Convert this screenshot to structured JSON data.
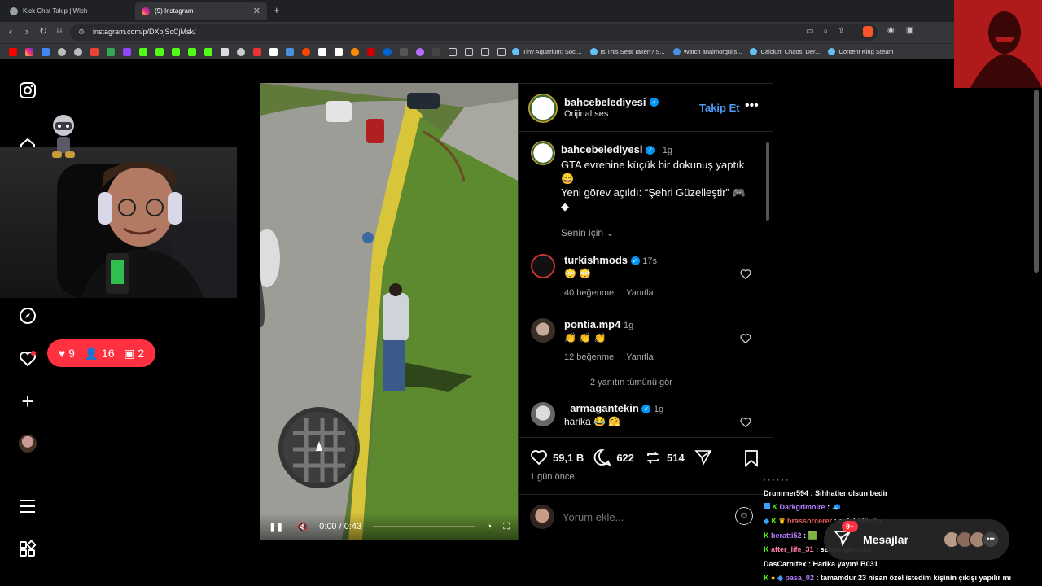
{
  "browser": {
    "tabs": [
      {
        "title": "Kick Chat Takip | Wich"
      },
      {
        "title": "(9) Instagram"
      }
    ],
    "url": "instagram.com/p/DXbjScCjMsk/",
    "bookmarks": [
      "Tiny Aquarium: Soci...",
      "Is This Seat Taken? S...",
      "Watch analmorgulis...",
      "Calcium Chaos: Der...",
      "Content King Steam"
    ]
  },
  "notifications": {
    "likes": "9",
    "follows": "16",
    "tags": "2"
  },
  "post": {
    "username": "bahcebelediyesi",
    "audio": "Orijinal ses",
    "follow": "Takip Et",
    "caption_time": "1g",
    "caption_line1": "GTA evrenine küçük bir dokunuş yaptık",
    "caption_line2": "Yeni görev açıldı: “Şehri Güzelleştir”",
    "for_you": "Senin için",
    "comments": [
      {
        "user": "turkishmods",
        "time": "17s",
        "text": "😳 😳",
        "likes": "40 beğenme",
        "reply": "Yanıtla"
      },
      {
        "user": "pontia.mp4",
        "time": "1g",
        "text": "👏 👏 👏",
        "likes": "12 beğenme",
        "reply": "Yanıtla"
      },
      {
        "user": "_armagantekin",
        "time": "1g",
        "text": "harika 😂 🤗",
        "likes": "",
        "reply": ""
      }
    ],
    "view_replies": "2 yanıtın tümünü gör",
    "like_count": "59,1 B",
    "comment_count": "622",
    "repost_count": "514",
    "posted": "1 gün önce",
    "comment_placeholder": "Yorum ekle...",
    "video_time": "0:00 / 0:43"
  },
  "chat": [
    {
      "user": "Drummer594",
      "msg": ": Sıhhatler olsun bedir",
      "color": "#ffffff"
    },
    {
      "user": "Darkgrimoire",
      "msg": ": 🧢",
      "color": "#b57bff"
    },
    {
      "user": "brassorcerer",
      "msg": ": çok kötüsün",
      "color": "#e05a5a"
    },
    {
      "user": "beratti52",
      "msg": ": 🟩",
      "color": "#b57bff"
    },
    {
      "user": "after_life_31",
      "msg": ": selam yakışıklı",
      "color": "#ff7aa8"
    },
    {
      "user": "DasCarnifex",
      "msg": ": Harika yayın! B031",
      "color": "#ffffff"
    },
    {
      "user": "pasa_02",
      "msg": ": tamamdur 23 nisan özel istedim kişinin çıkışı yapılır mı",
      "color": "#b57bff"
    }
  ],
  "messages": {
    "label": "Mesajlar",
    "badge": "9+"
  }
}
